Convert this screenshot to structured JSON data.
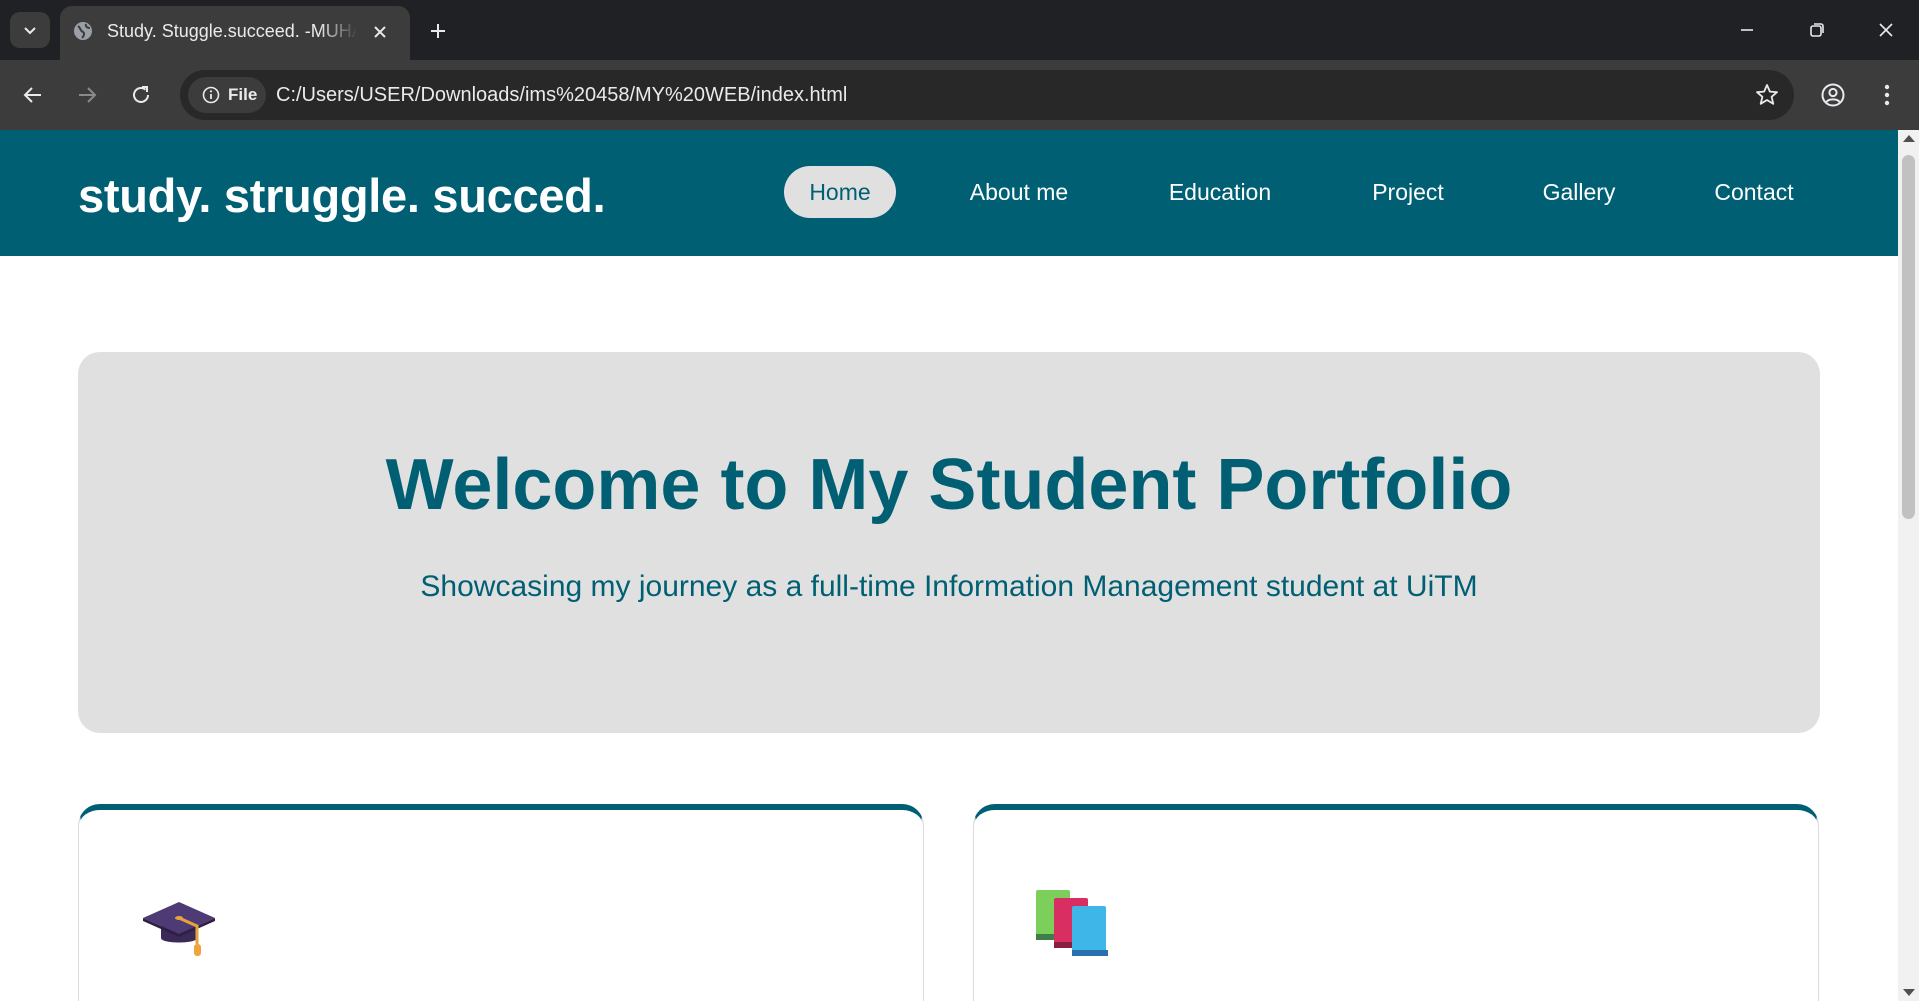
{
  "browser": {
    "tab_title": "Study. Stuggle.succeed. -MUHAMMAD",
    "file_chip_label": "File",
    "url": "C:/Users/USER/Downloads/ims%20458/MY%20WEB/index.html",
    "icons": [
      "tab-search-icon",
      "globe-icon",
      "close-icon",
      "plus-icon",
      "minimize-icon",
      "restore-icon",
      "back-icon",
      "forward-icon",
      "reload-icon",
      "info-icon",
      "star-icon",
      "profile-icon",
      "kebab-menu-icon"
    ]
  },
  "site": {
    "brand": "study. struggle. succed.",
    "nav": [
      {
        "label": "Home",
        "active": true
      },
      {
        "label": "About me",
        "active": false
      },
      {
        "label": "Education",
        "active": false
      },
      {
        "label": "Project",
        "active": false
      },
      {
        "label": "Gallery",
        "active": false
      },
      {
        "label": "Contact",
        "active": false
      }
    ],
    "hero": {
      "title": "Welcome to My Student Portfolio",
      "subtitle": "Showcasing my journey as a full-time Information Management student at UiTM"
    },
    "cards": [
      {
        "icon": "graduation-cap-icon"
      },
      {
        "icon": "books-icon"
      }
    ]
  },
  "colors": {
    "brand": "#005f73",
    "hero_bg": "#e0e0e0",
    "chrome_dark": "#202124",
    "chrome_toolbar": "#3c3c3c"
  }
}
